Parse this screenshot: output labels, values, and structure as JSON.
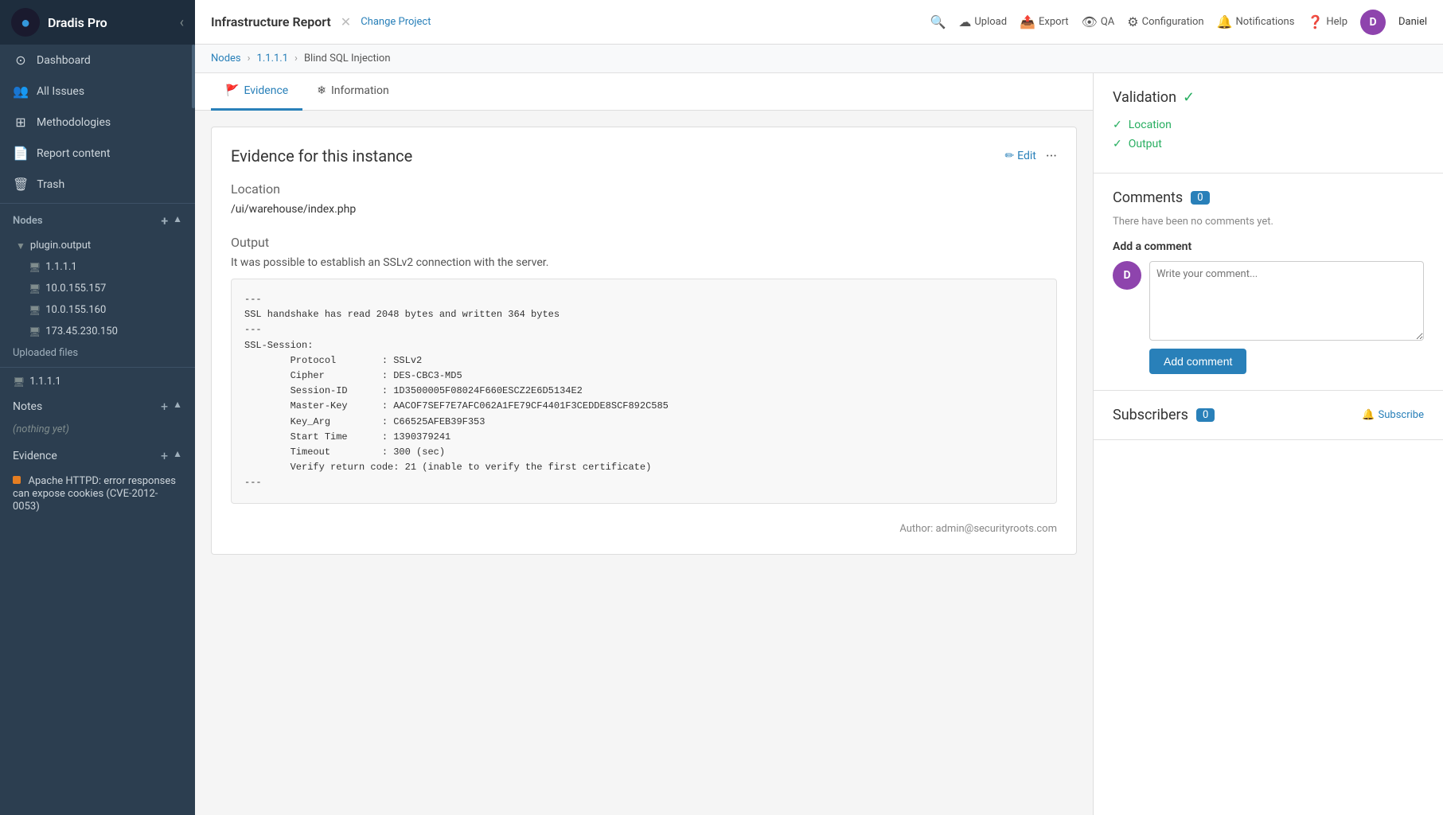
{
  "sidebar": {
    "app_name": "Dradis Pro",
    "logo_char": "D",
    "nav_items": [
      {
        "id": "dashboard",
        "label": "Dashboard",
        "icon": "⊙"
      },
      {
        "id": "all-issues",
        "label": "All Issues",
        "icon": "👤"
      },
      {
        "id": "methodologies",
        "label": "Methodologies",
        "icon": "☰"
      },
      {
        "id": "report-content",
        "label": "Report content",
        "icon": "📄"
      },
      {
        "id": "trash",
        "label": "Trash",
        "icon": "🗑"
      }
    ],
    "nodes_section": "Nodes",
    "plugin_output": "plugin.output",
    "nodes": [
      {
        "id": "1.1.1.1",
        "label": "1.1.1.1"
      },
      {
        "id": "10.0.155.157",
        "label": "10.0.155.157"
      },
      {
        "id": "10.0.155.160",
        "label": "10.0.155.160"
      },
      {
        "id": "173.45.230.150",
        "label": "173.45.230.150"
      }
    ],
    "uploaded_files": "Uploaded files",
    "node_1111": "1.1.1.1",
    "notes_label": "Notes",
    "nothing_yet": "(nothing yet)",
    "evidence_label": "Evidence",
    "evidence_items": [
      {
        "id": "apache-httpd",
        "label": "Apache HTTPD: error responses can expose cookies (CVE-2012-0053)"
      }
    ]
  },
  "topbar": {
    "project_title": "Infrastructure Report",
    "change_project": "Change Project",
    "actions": [
      {
        "id": "search",
        "label": "",
        "icon": "🔍"
      },
      {
        "id": "upload",
        "label": "Upload",
        "icon": "☁"
      },
      {
        "id": "export",
        "label": "Export",
        "icon": "📤"
      },
      {
        "id": "qa",
        "label": "QA",
        "icon": "👁"
      },
      {
        "id": "configuration",
        "label": "Configuration",
        "icon": "⚙"
      },
      {
        "id": "notifications",
        "label": "Notifications",
        "icon": "🔔"
      },
      {
        "id": "help",
        "label": "Help",
        "icon": "❓"
      }
    ],
    "user_name": "Daniel",
    "user_char": "D"
  },
  "breadcrumb": {
    "nodes": "Nodes",
    "ip": "1.1.1.1",
    "page": "Blind SQL Injection"
  },
  "tabs": [
    {
      "id": "evidence",
      "label": "Evidence",
      "icon": "🚩",
      "active": true
    },
    {
      "id": "information",
      "label": "Information",
      "icon": "❄"
    }
  ],
  "evidence": {
    "title": "Evidence for this instance",
    "edit_label": "Edit",
    "location_label": "Location",
    "location_value": "/ui/warehouse/index.php",
    "output_label": "Output",
    "output_description": "It was possible to establish an SSLv2 connection with the server.",
    "code_content": "---\nSSL handshake has read 2048 bytes and written 364 bytes\n---\nSSL-Session:\n        Protocol        : SSLv2\n        Cipher          : DES-CBC3-MD5\n        Session-ID      : 1D3500005F08024F660ESCZ2E6D5134E2\n        Master-Key      : AACOF7SEF7E7AFC062A1FE79CF4401F3CEDDE8SCF892C585\n        Key_Arg         : C66525AFEB39F353\n        Start Time      : 1390379241\n        Timeout         : 300 (sec)\n        Verify return code: 21 (inable to verify the first certificate)\n---",
    "author": "Author: admin@securityroots.com"
  },
  "validation": {
    "title": "Validation",
    "items": [
      "Location",
      "Output"
    ]
  },
  "comments": {
    "title": "Comments",
    "count": "0",
    "no_comments_text": "There have been no comments yet.",
    "add_comment_label": "Add a comment",
    "textarea_placeholder": "Write your comment...",
    "add_button": "Add comment"
  },
  "subscribers": {
    "title": "Subscribers",
    "count": "0",
    "subscribe_label": "Subscribe"
  }
}
